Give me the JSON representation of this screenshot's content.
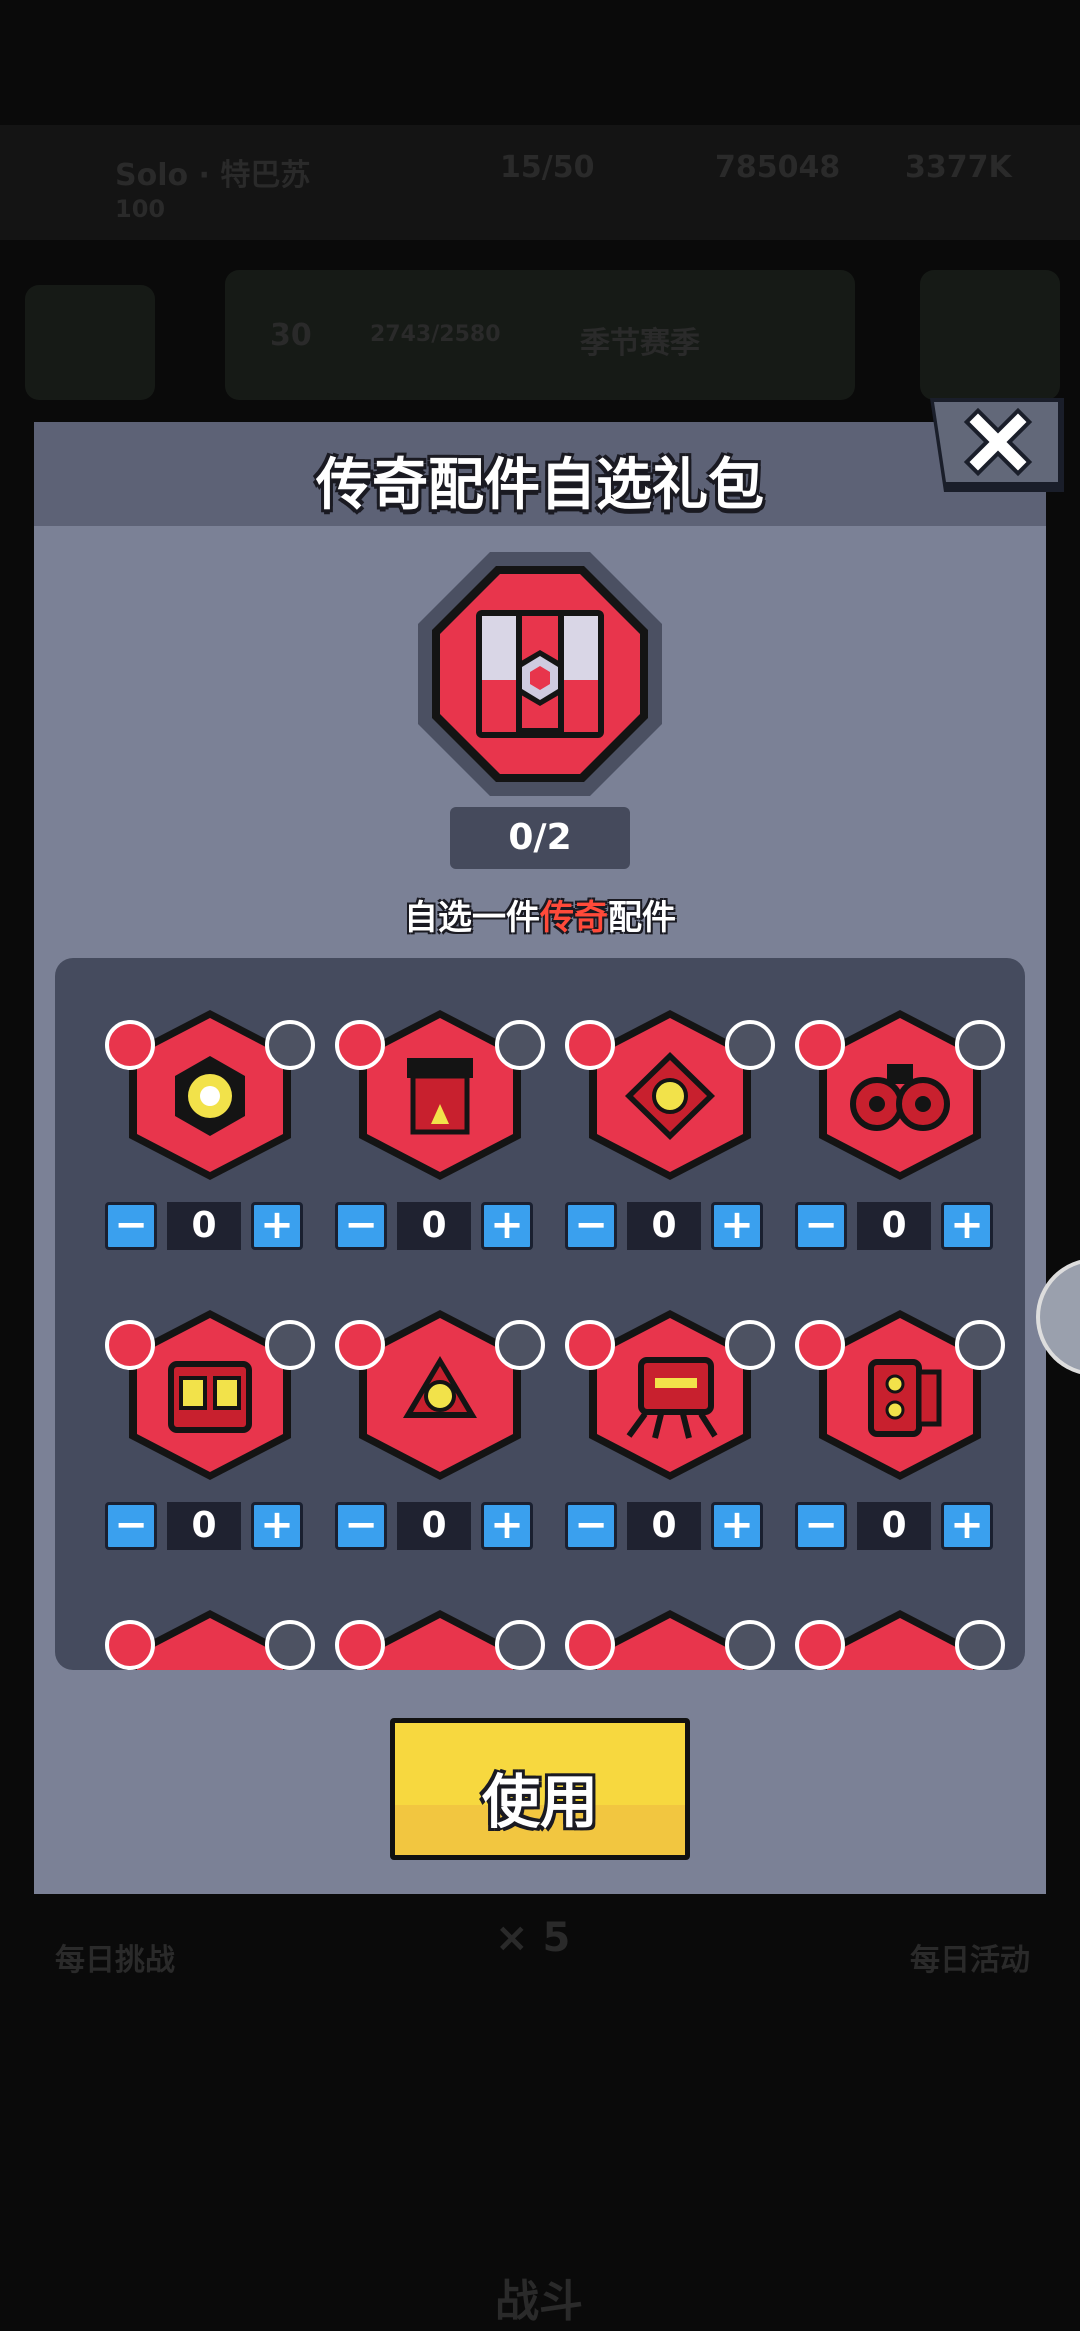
{
  "background": {
    "player_name": "Solo · 特巴苏",
    "player_level": "100",
    "energy": "15/50",
    "coins": "785048",
    "gems": "3377K",
    "level_badge": "30",
    "xp": "2743/2580",
    "season_label": "季节赛季",
    "bottom_left": "每日挑战",
    "bottom_mid": "× 5",
    "bottom_right": "每日活动",
    "battle_label": "战斗"
  },
  "modal": {
    "title": "传奇配件自选礼包",
    "close_icon": "close-icon",
    "counter": "0/2",
    "subtitle_prefix": "自选一件",
    "subtitle_highlight": "传奇",
    "subtitle_suffix": "配件",
    "use_button": "使用"
  },
  "items": [
    {
      "icon": "drone-core-icon",
      "badge": "bottle-icon",
      "count": "0",
      "minus": "−",
      "plus": "+"
    },
    {
      "icon": "red-armor-icon",
      "badge": "fire-creature-icon",
      "count": "0",
      "minus": "−",
      "plus": "+"
    },
    {
      "icon": "target-core-icon",
      "badge": "camera-icon",
      "count": "0",
      "minus": "−",
      "plus": "+"
    },
    {
      "icon": "twin-wheel-icon",
      "badge": "soccer-ball-icon",
      "count": "0",
      "minus": "−",
      "plus": "+"
    },
    {
      "icon": "robot-head-icon",
      "badge": "drill-icon",
      "count": "0",
      "minus": "−",
      "plus": "+"
    },
    {
      "icon": "spinner-icon",
      "badge": "croissant-icon",
      "count": "0",
      "minus": "−",
      "plus": "+"
    },
    {
      "icon": "spider-bot-icon",
      "badge": "virus-icon",
      "count": "0",
      "minus": "−",
      "plus": "+"
    },
    {
      "icon": "cannon-icon",
      "badge": "boomerang-icon",
      "count": "0",
      "minus": "−",
      "plus": "+"
    },
    {
      "icon": "gadget-icon",
      "badge": "brick-icon"
    },
    {
      "icon": "gadget-icon",
      "badge": "radiation-icon"
    },
    {
      "icon": "gadget-icon",
      "badge": "cactus-icon"
    },
    {
      "icon": "gadget-icon",
      "badge": "rocket-icon"
    }
  ],
  "colors": {
    "legendary_red": "#e8354c",
    "modal_bg": "#7b8196",
    "stepper_blue": "#3aa0ee",
    "use_yellow": "#f7d83f"
  }
}
